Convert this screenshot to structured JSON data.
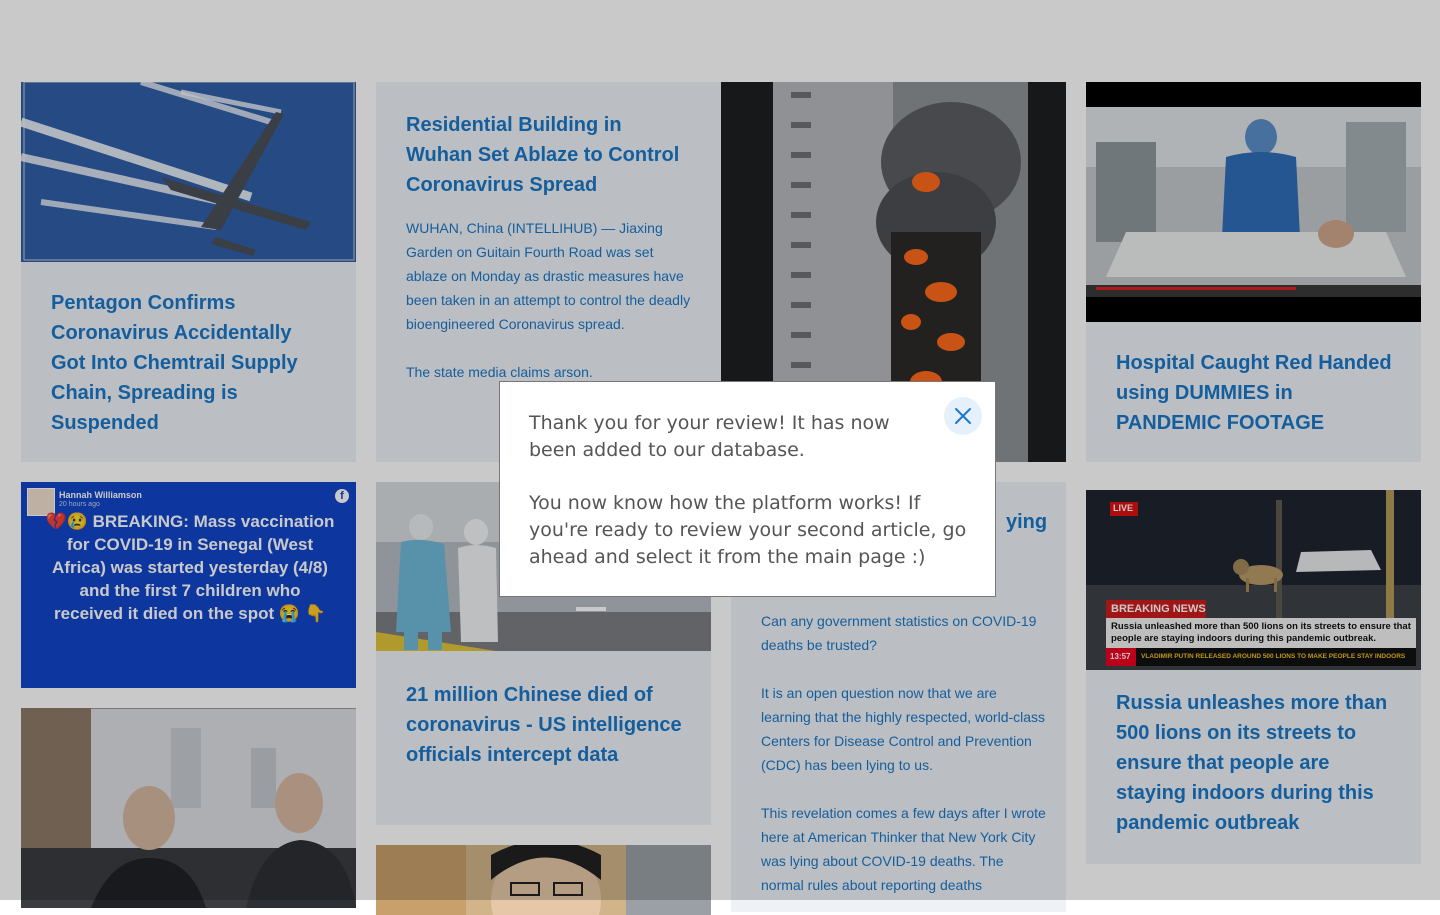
{
  "cards": {
    "c1": {
      "title": "Pentagon Confirms Coronavirus Accidentally Got Into Chemtrail Supply Chain, Spreading is Suspended",
      "image": "airplane-chemtrails-photo"
    },
    "c2": {
      "title": "Residential Building in Wuhan Set Ablaze to Control Coronavirus Spread",
      "body": "WUHAN, China (INTELLIHUB) — Jiaxing Garden on Guitain Fourth Road was set ablaze on Monday as drastic measures have been taken in an attempt to control the deadly bioengineered Coronavirus spread.\n\nThe state media claims arson.",
      "image": "burning-tower-photo"
    },
    "c3": {
      "title": "Hospital Caught Red Handed using DUMMIES in PANDEMIC FOOTAGE",
      "image": "hospital-video-still"
    },
    "c4": {
      "post_author": "Hannah Williamson",
      "post_time": "20 hours ago",
      "post_text": "💔😢 BREAKING: Mass vaccination for COVID-19 in Senegal (West Africa) was started yesterday (4/8) and the first 7 children who received it died on the spot 😭 👇",
      "image": "facebook-post-screenshot"
    },
    "c5": {
      "title": "21 million Chinese died of coronavirus - US intelligence officials intercept data",
      "image": "hazmat-workers-photo"
    },
    "c6": {
      "title_fragment": "ying",
      "body": "Can any government statistics on COVID-19 deaths be trusted?\n\nIt is an open question now that we are learning that the highly respected, world-class Centers for Disease Control and Prevention (CDC) has been lying to us.\n\nThis revelation comes a few days after I wrote here at American Thinker that New York City was lying about COVID-19 deaths. The normal rules about reporting deaths"
    },
    "c7": {
      "title": "Russia unleashes more than 500 lions on its streets to ensure that people are staying indoors during this pandemic outbreak",
      "live": "LIVE",
      "banner": "BREAKING NEWS",
      "ticker1": "Russia unleashed more than 500 lions on its streets to ensure that people are staying indoors during this pandemic outbreak.",
      "clock": "13:57",
      "ticker2": "VLADIMIR PUTIN RELEASED AROUND 500 LIONS TO MAKE PEOPLE STAY INDOORS",
      "image": "lion-street-news-still"
    },
    "c8": {
      "image": "two-men-photo"
    },
    "c9": {
      "image": "man-portrait-photo"
    }
  },
  "modal": {
    "line1": "Thank you for your review! It has now been added to our database.",
    "line2": "You now know how the platform works! If you're ready to review your second article, go ahead and select it from the main page :)",
    "close_icon": "close-icon"
  },
  "colors": {
    "accent": "#1b78c8",
    "card_bg": "#eef2f7",
    "overlay": "rgba(0,0,0,0.21)"
  }
}
